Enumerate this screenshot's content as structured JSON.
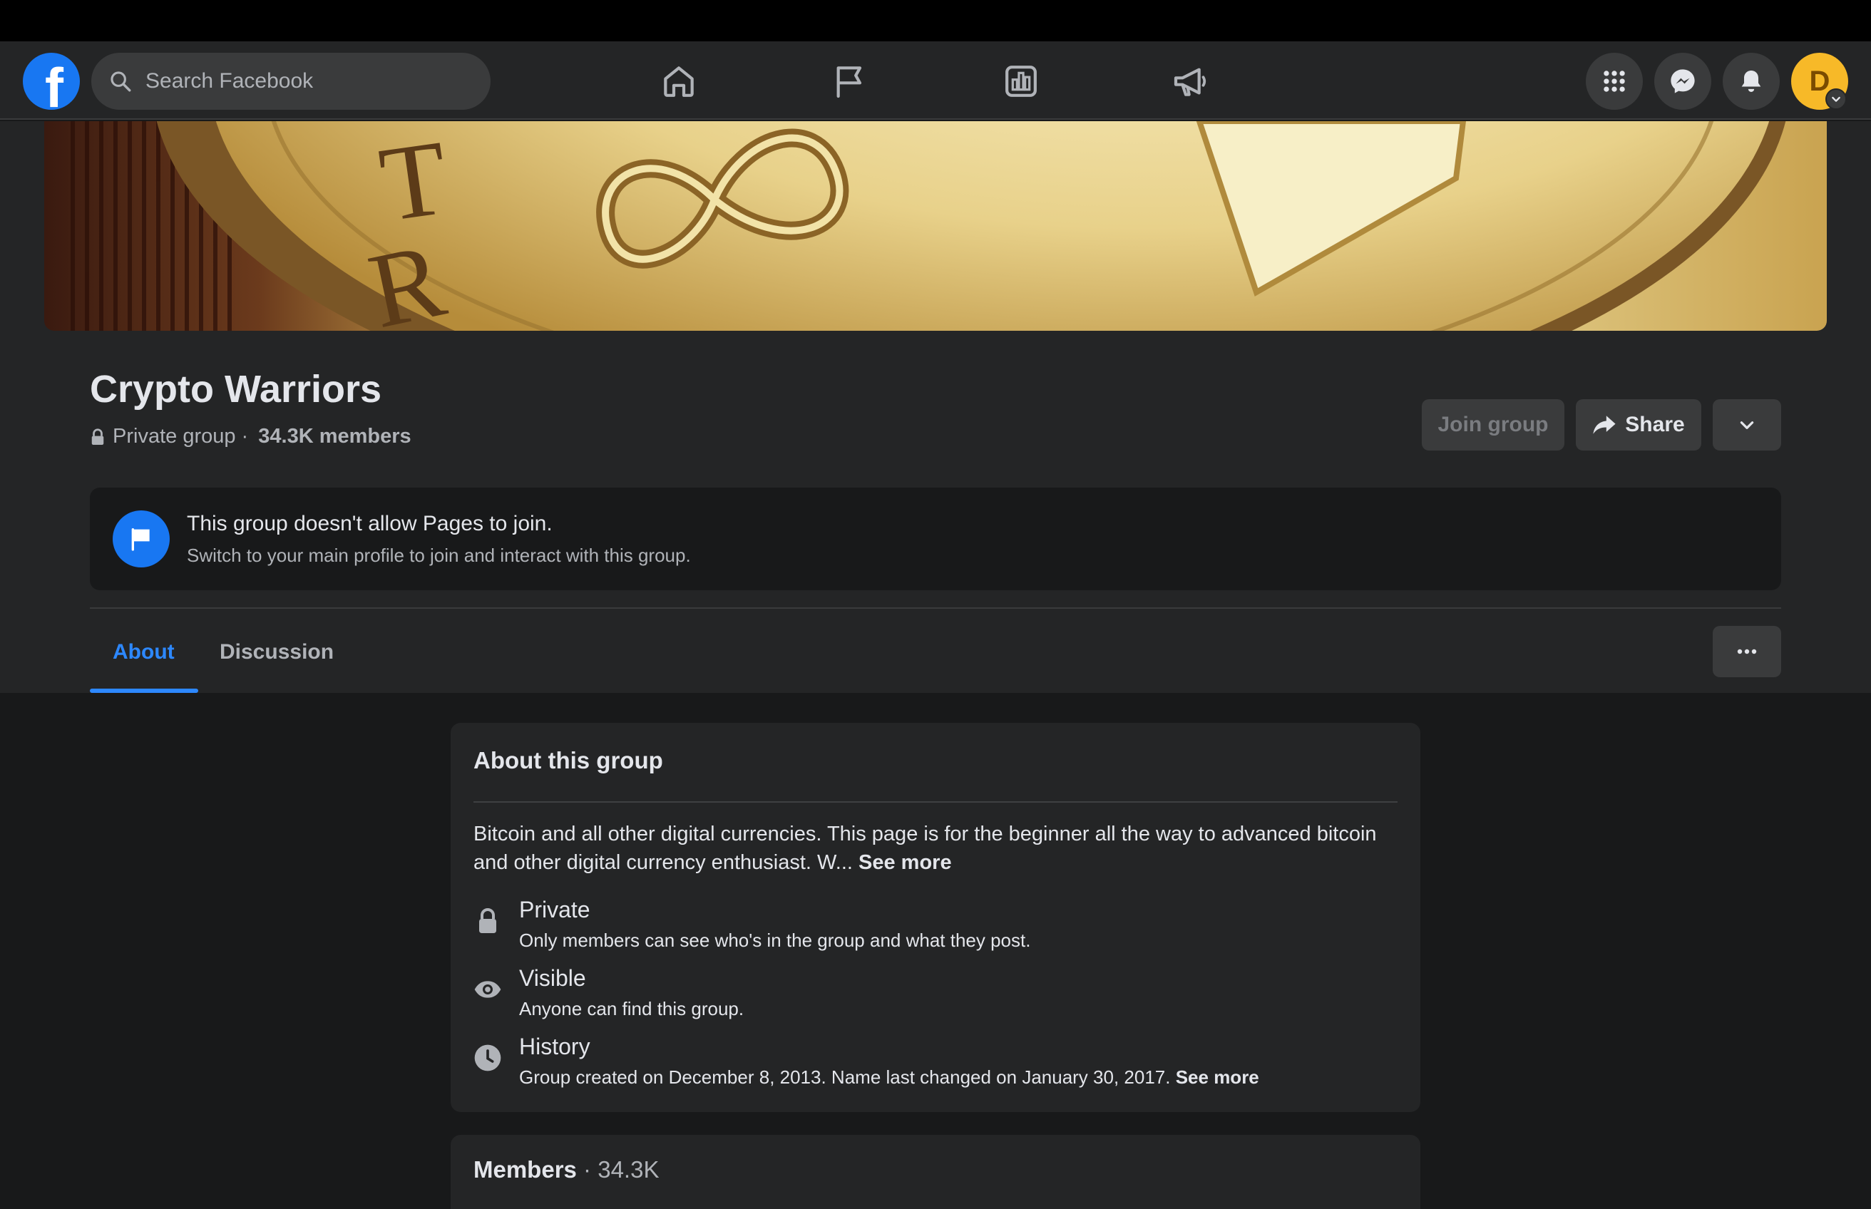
{
  "navbar": {
    "search_placeholder": "Search Facebook",
    "avatar_initial": "D"
  },
  "group": {
    "name": "Crypto Warriors",
    "privacy": "Private group",
    "separator": " · ",
    "members": "34.3K members"
  },
  "actions": {
    "join": "Join group",
    "share": "Share"
  },
  "notice": {
    "title": "This group doesn't allow Pages to join.",
    "subtitle": "Switch to your main profile to join and interact with this group."
  },
  "tabs": [
    {
      "label": "About",
      "active": true
    },
    {
      "label": "Discussion",
      "active": false
    }
  ],
  "about": {
    "title": "About this group",
    "description": "Bitcoin and all other digital currencies. This page is for the beginner all the way to advanced bitcoin and other digital currency enthusiast. W... ",
    "see_more": "See more",
    "items": [
      {
        "icon": "lock-icon",
        "heading": "Private",
        "text": "Only members can see who's in the group and what they post."
      },
      {
        "icon": "eye-icon",
        "heading": "Visible",
        "text": "Anyone can find this group."
      },
      {
        "icon": "clock-icon",
        "heading": "History",
        "text": "Group created on December 8, 2013. Name last changed on January 30, 2017. ",
        "see_more": "See more"
      }
    ]
  },
  "members_card": {
    "title": "Members",
    "separator": " · ",
    "count": "34.3K"
  },
  "colors": {
    "accent": "#2d88ff",
    "brand": "#1877f2",
    "background": "#18191a",
    "surface": "#242526",
    "avatar": "#f7b928"
  }
}
